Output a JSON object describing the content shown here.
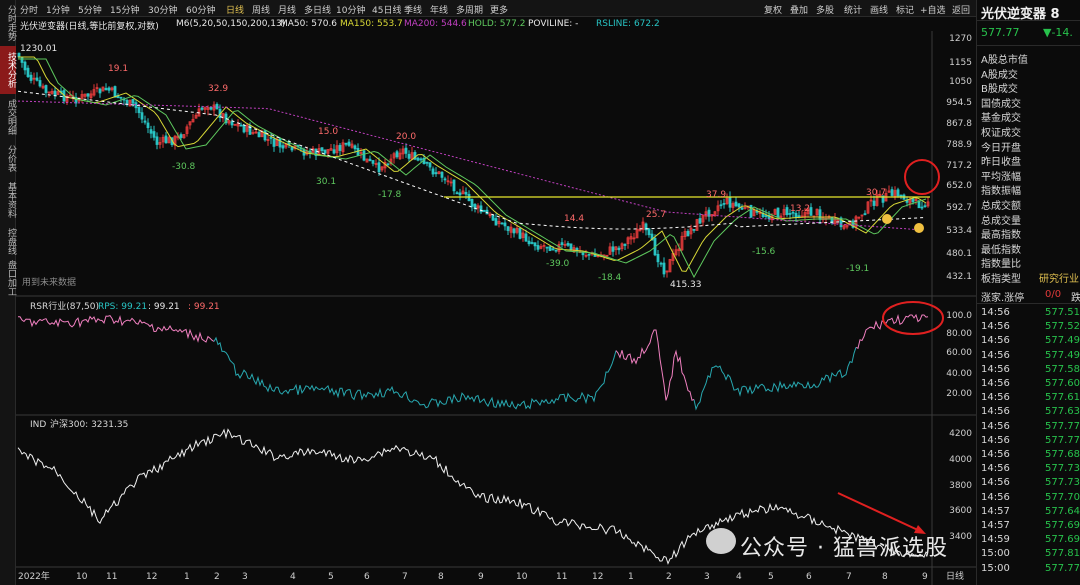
{
  "left_tabs": [
    "分时走势",
    "技术分析",
    "成交明细",
    "分价表",
    "基本资料",
    "控盘线",
    "盘口加工"
  ],
  "toolbar": {
    "periods": [
      "分时",
      "1分钟",
      "5分钟",
      "15分钟",
      "30分钟",
      "60分钟",
      "日线",
      "周线",
      "月线",
      "多日线",
      "10分钟",
      "45日线",
      "季线",
      "年线",
      "多周期",
      "更多"
    ],
    "active_period": "日线",
    "right_buttons": [
      "复权",
      "叠加",
      "多股",
      "统计",
      "画线",
      "标记",
      "+自选",
      "返回"
    ]
  },
  "indicator_line": {
    "name": "光伏逆变器(日线,等比前复权,对数)",
    "m6": "M6(5,20,50,150,200,13)",
    "ma50": "MA50: 570.6",
    "ma150": "MA150: 553.7",
    "ma200": "MA200: 544.6",
    "hold": "HOLD: 577.2",
    "poviline": "POVILINE: -",
    "rsline": "RSLINE: 672.2"
  },
  "main_chart": {
    "y_ticks": [
      "1270",
      "1155",
      "1050",
      "954.5",
      "867.8",
      "788.9",
      "717.2",
      "652.0",
      "592.7",
      "533.4",
      "480.1",
      "432.1"
    ],
    "annotations": [
      "1230.01",
      "19.1",
      "32.9",
      "15.0",
      "20.0",
      "-30.8",
      "30.1",
      "-17.8",
      "14.4",
      "-39.0",
      "25.7",
      "-18.4",
      "415.33",
      "37.9",
      "13.2",
      "-15.6",
      "30.7",
      "-19.1"
    ],
    "no_future_data": "用到未来数据",
    "colors": {
      "up": "#e23a3a",
      "down": "#28c4c4",
      "ma_yellow": "#d8d836",
      "ma_green": "#5ec85e",
      "ma_magenta": "#c040c0",
      "ma_white_dash": "#ffffff"
    }
  },
  "rsr_panel": {
    "label": "RSR行业(87,50)",
    "rps": "RPS: 99.21",
    "v1": ": 99.21",
    "v2": ": 99.21",
    "y_ticks": [
      "100.0",
      "80.00",
      "60.00",
      "40.00",
      "20.00"
    ]
  },
  "ind_panel": {
    "label": "IND",
    "index": "沪深300: 3231.35",
    "y_ticks": [
      "4200",
      "4000",
      "3800",
      "3600",
      "3400"
    ]
  },
  "x_axis": {
    "labels": [
      "2022年",
      "10",
      "11",
      "12",
      "1",
      "2",
      "3",
      "4",
      "5",
      "6",
      "7",
      "8",
      "9",
      "10",
      "11",
      "12",
      "1",
      "2",
      "3",
      "4",
      "5",
      "6",
      "7",
      "8",
      "9"
    ],
    "right_label": "日线"
  },
  "right_panel": {
    "title": "光伏逆变器 8",
    "price": "577.77",
    "change": "▼-14.",
    "rows": [
      "A股总市值",
      "A股成交",
      "B股成交",
      "国债成交",
      "基金成交",
      "权证成交",
      "今日开盘",
      "昨日收盘",
      "平均涨幅",
      "指数振幅",
      "总成交额",
      "总成交量",
      "最高指数",
      "最低指数",
      "指数量比",
      "板指类型"
    ],
    "board_type_value": "研究行业",
    "limit_row": {
      "label": "涨家.涨停",
      "value": "0/0",
      "tail": "跌"
    },
    "ticks": [
      {
        "time": "14:56",
        "price": "577.51"
      },
      {
        "time": "14:56",
        "price": "577.52"
      },
      {
        "time": "14:56",
        "price": "577.49"
      },
      {
        "time": "14:56",
        "price": "577.49"
      },
      {
        "time": "14:56",
        "price": "577.58"
      },
      {
        "time": "14:56",
        "price": "577.60"
      },
      {
        "time": "14:56",
        "price": "577.61"
      },
      {
        "time": "14:56",
        "price": "577.63"
      },
      {
        "time": "14:56",
        "price": "577.77"
      },
      {
        "time": "14:56",
        "price": "577.77"
      },
      {
        "time": "14:56",
        "price": "577.68"
      },
      {
        "time": "14:56",
        "price": "577.73"
      },
      {
        "time": "14:56",
        "price": "577.73"
      },
      {
        "time": "14:56",
        "price": "577.70"
      },
      {
        "time": "14:57",
        "price": "577.64"
      },
      {
        "time": "14:57",
        "price": "577.69"
      },
      {
        "time": "14:59",
        "price": "577.69"
      },
      {
        "time": "15:00",
        "price": "577.81"
      },
      {
        "time": "15:00",
        "price": "577.77"
      }
    ]
  },
  "watermark": "公众号 · 猛兽派选股"
}
